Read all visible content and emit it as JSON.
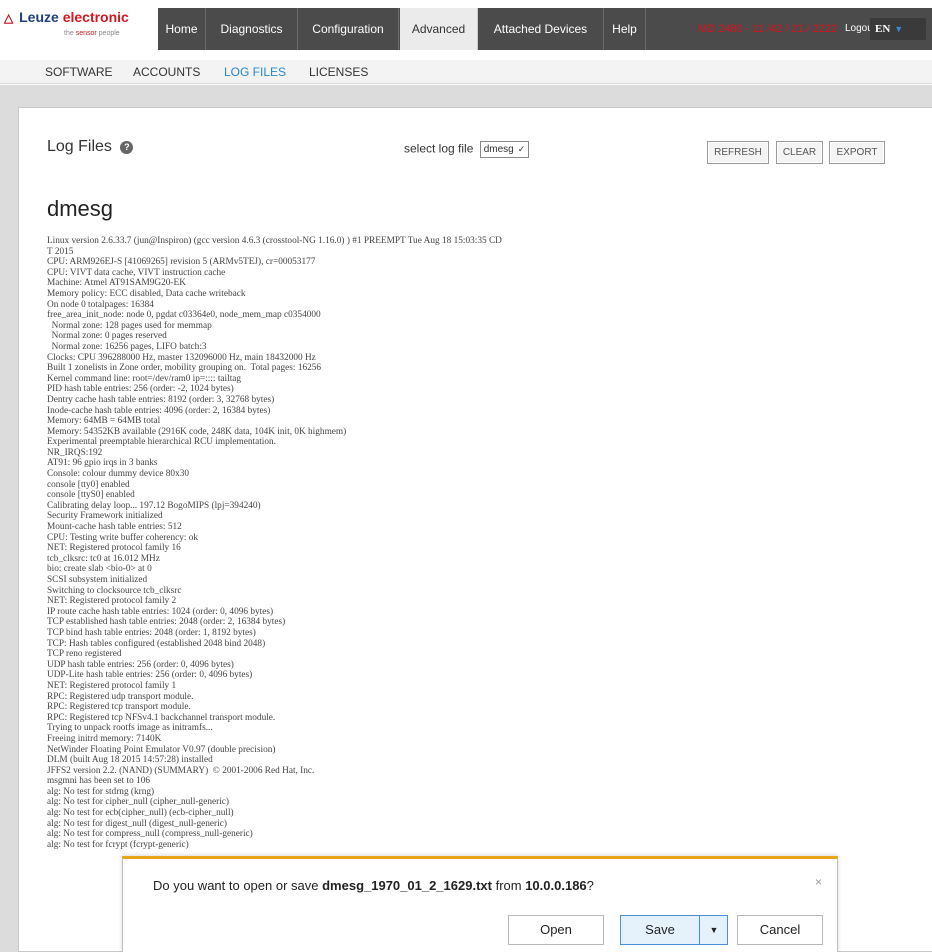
{
  "header": {
    "logo": {
      "brand_first": "Leuze",
      "brand_second": "electronic",
      "tagline_before": "the",
      "tagline_highlight": "sensor",
      "tagline_after": "people"
    },
    "nav": [
      "Home",
      "Diagnostics",
      "Configuration",
      "Advanced",
      "Attached Devices",
      "Help"
    ],
    "active_nav": "Advanced",
    "device_id": "MD 2480 - 11 /42 / 21 / 2222",
    "logout_label": "Logout",
    "language": "EN"
  },
  "subnav": {
    "items": [
      "SOFTWARE",
      "ACCOUNTS",
      "LOG FILES",
      "LICENSES"
    ],
    "active": "LOG FILES"
  },
  "page": {
    "title": "Log Files",
    "select_label": "select log file",
    "select_value": "dmesg",
    "buttons": {
      "refresh": "REFRESH",
      "clear": "CLEAR",
      "export": "EXPORT"
    },
    "log_heading": "dmesg",
    "log_lines": [
      "Linux version 2.6.33.7 (jun@Inspiron) (gcc version 4.6.3 (crosstool-NG 1.16.0) ) #1 PREEMPT Tue Aug 18 15:03:35 CD",
      "T 2015",
      "CPU: ARM926EJ-S [41069265] revision 5 (ARMv5TEJ), cr=00053177",
      "CPU: VIVT data cache, VIVT instruction cache",
      "Machine: Atmel AT91SAM9G20-EK",
      "Memory policy: ECC disabled, Data cache writeback",
      "On node 0 totalpages: 16384",
      "free_area_init_node: node 0, pgdat c03364e0, node_mem_map c0354000",
      "  Normal zone: 128 pages used for memmap",
      "  Normal zone: 0 pages reserved",
      "  Normal zone: 16256 pages, LIFO batch:3",
      "Clocks: CPU 396288000 Hz, master 132096000 Hz, main 18432000 Hz",
      "Built 1 zonelists in Zone order, mobility grouping on.  Total pages: 16256",
      "Kernel command line: root=/dev/ram0 ip=:::: tailtag",
      "PID hash table entries: 256 (order: -2, 1024 bytes)",
      "Dentry cache hash table entries: 8192 (order: 3, 32768 bytes)",
      "Inode-cache hash table entries: 4096 (order: 2, 16384 bytes)",
      "Memory: 64MB = 64MB total",
      "Memory: 54352KB available (2916K code, 248K data, 104K init, 0K highmem)",
      "Experimental preemptable hierarchical RCU implementation.",
      "NR_IRQS:192",
      "AT91: 96 gpio irqs in 3 banks",
      "Console: colour dummy device 80x30",
      "console [tty0] enabled",
      "console [ttyS0] enabled",
      "Calibrating delay loop... 197.12 BogoMIPS (lpj=394240)",
      "Security Framework initialized",
      "Mount-cache hash table entries: 512",
      "CPU: Testing write buffer coherency: ok",
      "NET: Registered protocol family 16",
      "tcb_clksrc: tc0 at 16.012 MHz",
      "bio: create slab <bio-0> at 0",
      "SCSI subsystem initialized",
      "Switching to clocksource tcb_clksrc",
      "NET: Registered protocol family 2",
      "IP route cache hash table entries: 1024 (order: 0, 4096 bytes)",
      "TCP established hash table entries: 2048 (order: 2, 16384 bytes)",
      "TCP bind hash table entries: 2048 (order: 1, 8192 bytes)",
      "TCP: Hash tables configured (established 2048 bind 2048)",
      "TCP reno registered",
      "UDP hash table entries: 256 (order: 0, 4096 bytes)",
      "UDP-Lite hash table entries: 256 (order: 0, 4096 bytes)",
      "NET: Registered protocol family 1",
      "RPC: Registered udp transport module.",
      "RPC: Registered tcp transport module.",
      "RPC: Registered tcp NFSv4.1 backchannel transport module.",
      "Trying to unpack rootfs image as initramfs...",
      "Freeing initrd memory: 7140K",
      "NetWinder Floating Point Emulator V0.97 (double precision)",
      "DLM (built Aug 18 2015 14:57:28) installed",
      "JFFS2 version 2.2. (NAND) (SUMMARY)  © 2001-2006 Red Hat, Inc.",
      "msgmni has been set to 106",
      "alg: No test for stdrng (krng)",
      "alg: No test for cipher_null (cipher_null-generic)",
      "alg: No test for ecb(cipher_null) (ecb-cipher_null)",
      "alg: No test for digest_null (digest_null-generic)",
      "alg: No test for compress_null (compress_null-generic)",
      "alg: No test for fcrypt (fcrypt-generic)"
    ]
  },
  "dialog": {
    "msg_prefix": "Do you want to open or save ",
    "filename": "dmesg_1970_01_2_1629.txt",
    "msg_middle": " from ",
    "host": "10.0.0.186",
    "msg_suffix": "?",
    "open_label": "Open",
    "save_label": "Save",
    "cancel_label": "Cancel",
    "close_glyph": "×"
  }
}
